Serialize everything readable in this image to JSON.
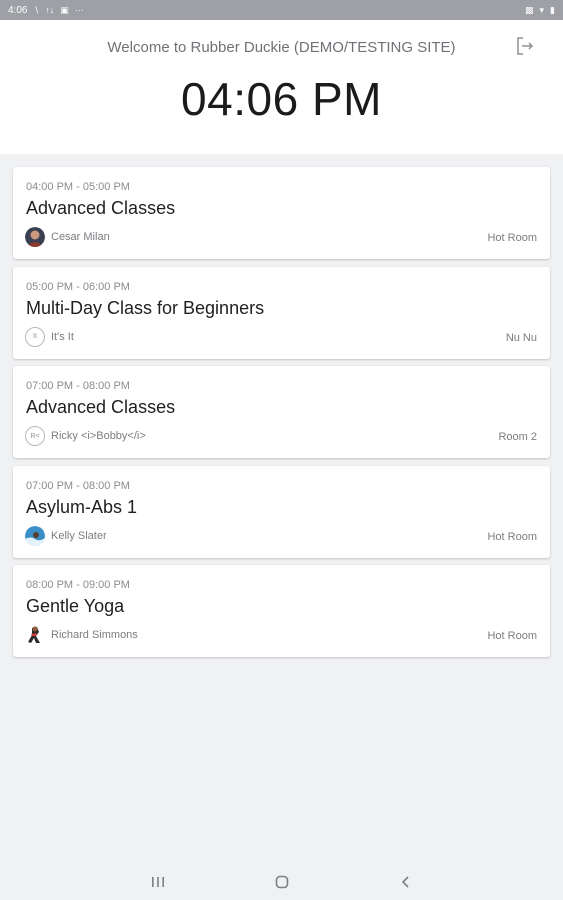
{
  "status_bar": {
    "time": "4:06",
    "left_icons": [
      "wifi-call-icon",
      "signal-icon",
      "image-icon",
      "more-icon"
    ],
    "right_icons": [
      "mute-icon",
      "wifi-icon",
      "battery-icon"
    ]
  },
  "header": {
    "welcome": "Welcome to Rubber Duckie (DEMO/TESTING SITE)",
    "clock": "04:06 PM",
    "logout_icon": "logout-icon"
  },
  "classes": [
    {
      "time": "04:00 PM - 05:00 PM",
      "title": "Advanced Classes",
      "instructor": "Cesar Milan",
      "avatar_type": "photo",
      "avatar_color": "#4a3b36",
      "room": "Hot Room"
    },
    {
      "time": "05:00 PM - 06:00 PM",
      "title": "Multi-Day Class for Beginners",
      "instructor": "It's  It",
      "avatar_type": "initials",
      "avatar_initials": "II",
      "room": "Nu Nu"
    },
    {
      "time": "07:00 PM - 08:00 PM",
      "title": "Advanced Classes",
      "instructor": "Ricky <i>Bobby</i>",
      "avatar_type": "initials",
      "avatar_initials": "R<",
      "room": "Room 2"
    },
    {
      "time": "07:00 PM - 08:00 PM",
      "title": "Asylum-Abs 1",
      "instructor": "Kelly Slater",
      "avatar_type": "photo",
      "avatar_color": "#3b8fc9",
      "room": "Hot Room"
    },
    {
      "time": "08:00 PM - 09:00 PM",
      "title": "Gentle Yoga",
      "instructor": "Richard Simmons",
      "avatar_type": "photo",
      "avatar_color": "#2b2b2b",
      "room": "Hot Room"
    }
  ],
  "nav_bar": {
    "icons": [
      "recent-apps-icon",
      "home-icon",
      "back-icon"
    ]
  }
}
